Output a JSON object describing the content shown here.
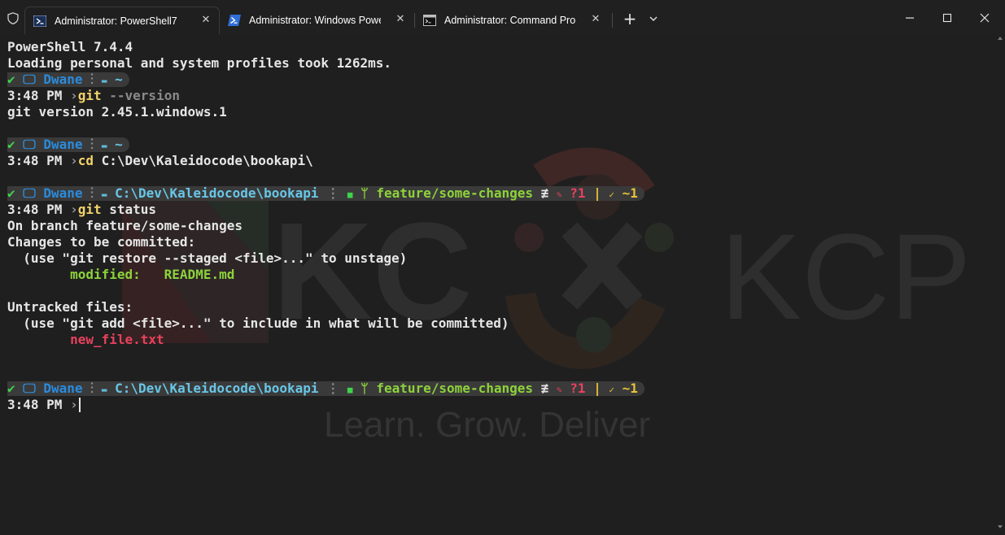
{
  "window": {
    "tabs": [
      {
        "title": "Administrator: PowerShell7",
        "icon": "powershell-icon"
      },
      {
        "title": "Administrator: Windows PowerShell",
        "icon": "windows-powershell-icon"
      },
      {
        "title": "Administrator: Command Prompt",
        "icon": "command-prompt-icon"
      }
    ],
    "new_tab": "+",
    "close_glyph": "✕"
  },
  "prompt": {
    "ok_glyph": "✔",
    "pc_glyph": "🖵",
    "user": "Dwane",
    "sep_glyph": "⋮",
    "folder_glyph": "▬",
    "home": "~",
    "path": "C:\\Dev\\Kaleidocode\\bookapi",
    "git_glyph": "■",
    "branch_glyph": "ᛘ",
    "branch": "feature/some-changes",
    "not_equal": "≢",
    "stage_glyph": "✎",
    "untracked": "?1",
    "pipe": "|",
    "work_glyph": "✓",
    "modified": "~1",
    "time": "3:48 PM",
    "chevron": "›"
  },
  "output": {
    "banner": "PowerShell 7.4.4",
    "profiles": "Loading personal and system profiles took 1262ms.",
    "cmd_git": "git",
    "cmd_git_version_arg": "--version",
    "git_version": "git version 2.45.1.windows.1",
    "cmd_cd": "cd",
    "cmd_cd_arg": "C:\\Dev\\Kaleidocode\\bookapi\\",
    "cmd_status_arg": "status",
    "on_branch": "On branch feature/some-changes",
    "changes_header": "Changes to be committed:",
    "restore_hint": "  (use \"git restore --staged <file>...\" to unstage)",
    "modified_label": "        modified:   ",
    "modified_file": "README.md",
    "untracked_header": "Untracked files:",
    "add_hint": "  (use \"git add <file>...\" to include in what will be committed)",
    "untracked_file": "        new_file.txt"
  },
  "watermark": {
    "left_text": "KC",
    "right_text": "KCP",
    "tagline": "Learn. Grow. Deliver"
  },
  "colors": {
    "background": "#1f1f1f",
    "ok": "#3fd34c",
    "user": "#2b8bdc",
    "path": "#68c6e6",
    "branch": "#8dd23b",
    "untracked": "#e8415e",
    "modified": "#e7c23a",
    "command": "#f2d36b"
  }
}
